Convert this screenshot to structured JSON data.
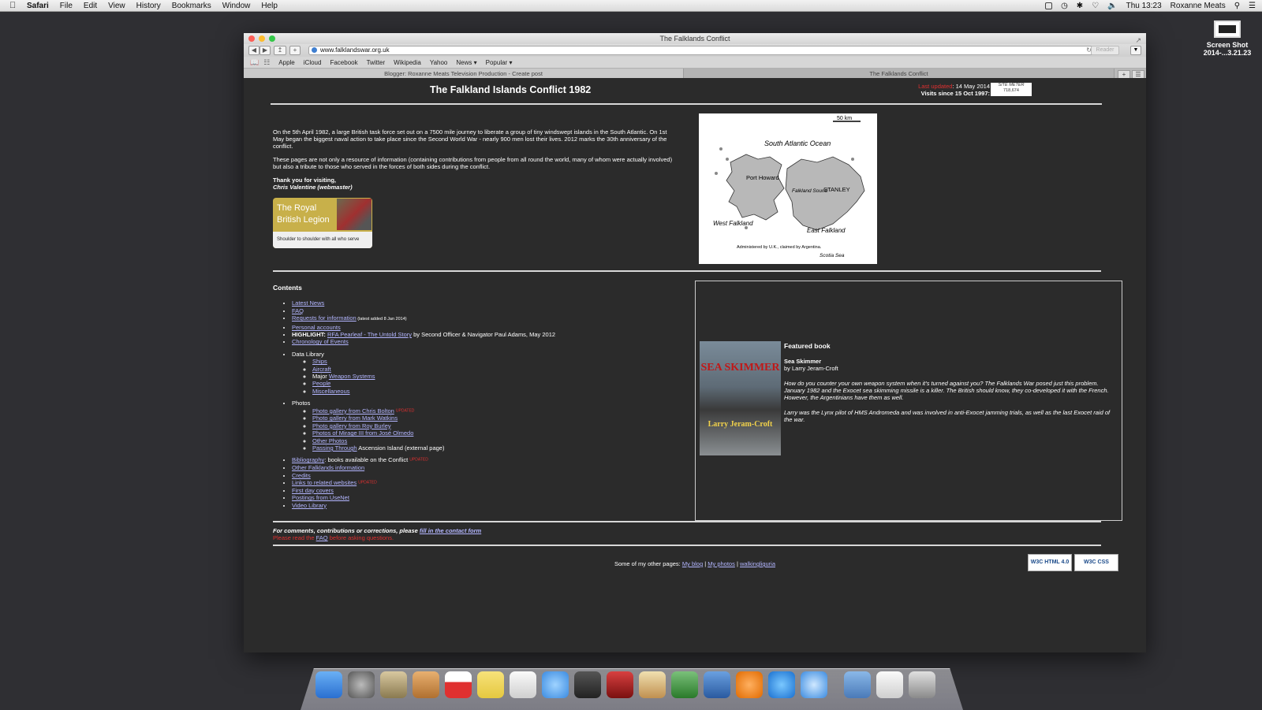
{
  "menubar": {
    "app": "Safari",
    "items": [
      "File",
      "Edit",
      "View",
      "History",
      "Bookmarks",
      "Window",
      "Help"
    ],
    "clock": "Thu 13:23",
    "user": "Roxanne Meats"
  },
  "desktop": {
    "icon_label_1": "Screen Shot",
    "icon_label_2": "2014-...3.21.23"
  },
  "window": {
    "title": "The Falklands Conflict",
    "url": "www.falklandswar.org.uk",
    "reader": "Reader",
    "bookmarks": [
      "Apple",
      "iCloud",
      "Facebook",
      "Twitter",
      "Wikipedia",
      "Yahoo",
      "News ▾",
      "Popular ▾"
    ],
    "tabs": [
      "Blogger: Roxanne Meats Television Production - Create post",
      "The Falklands Conflict"
    ]
  },
  "page": {
    "title": "The Falkland Islands Conflict 1982",
    "last_updated_label": "Last updated",
    "last_updated_value": ": 14 May 2014",
    "visits": "Visits since 15 Oct 1997:",
    "meter_label": "SITE METER",
    "meter_value": "718,674",
    "intro_p1": "On the 5th April 1982, a large British task force set out on a 7500 mile journey to liberate a group of tiny windswept islands in the South Atlantic. On 1st May began the biggest naval action to take place since the Second World War - nearly 900 men lost their lives. 2012 marks the 30th anniversary of the conflict.",
    "intro_p2": "These pages are not only a resource of information (containing contributions from people from all round the world, many of whom were actually involved) but also a tribute to those who served in the forces of both sides during the conflict.",
    "thanks": "Thank you for visiting,",
    "signature": "Chris Valentine (webmaster)",
    "legion": {
      "title": "The Royal British Legion",
      "tagline": "Shoulder to shoulder with all who serve"
    },
    "map": {
      "scale": "50 km",
      "ocean": "South Atlantic Ocean",
      "port_howard": "Port Howard",
      "falkland_sound": "Falkland Sound",
      "stanley": "STANLEY",
      "west": "West Falkland",
      "east": "East Falkland",
      "administered": "Administered by U.K., claimed by Argentina.",
      "scotia": "Scotia Sea"
    },
    "contents": {
      "heading": "Contents",
      "latest_news": "Latest News",
      "faq": "FAQ",
      "requests": "Requests for information",
      "requests_note": " (latest added 8 Jan 2014)",
      "personal": "Personal accounts",
      "highlight_label": "HIGHLIGHT: ",
      "highlight_link": "RFA Pearleaf - The Untold Story",
      "highlight_rest": " by Second Officer & Navigator Paul Adams, May 2012",
      "chronology": "Chronology of Events",
      "data_library": "Data Library",
      "ships": "Ships",
      "aircraft": "Aircraft",
      "major": "Major ",
      "weapons": "Weapon Systems",
      "people": "People",
      "misc": "Miscellaneous",
      "photos": "Photos",
      "gal1": "Photo gallery from Chris Bolton",
      "gal2": "Photo gallery from Mark Watkins",
      "gal3": "Photo gallery from Roy Burley",
      "gal4": "Photos of Mirage III from José Olmedo",
      "gal5": "Other Photos",
      "passing": "Passing Through",
      "passing_rest": " Ascension Island (external page)",
      "biblio": "Bibliography",
      "biblio_rest": ": books available on the Conflict",
      "other_info": "Other Falklands information",
      "credits": "Credits",
      "links": "Links to related websites",
      "first_day": "First day covers",
      "usenet": "Postings from UseNet",
      "video": "Video Library",
      "updated": "UPDATED"
    },
    "featured": {
      "heading": "Featured book",
      "book_title": "Sea Skimmer",
      "author": "by Larry Jeram-Croft",
      "cover_title": "SEA SKIMMER",
      "cover_author": "Larry Jeram-Croft",
      "p1": "How do you counter your own weapon system when it's turned against you? The Falklands War posed just this problem. January 1982 and the Exocet sea skimming missile is a killer. The British should know, they co-developed it with the French. However, the Argentinians have them as well.",
      "p2": "Larry was the Lynx pilot of HMS Andromeda and was involved in anti-Exocet jamming trials, as well as the last Exocet raid of the war."
    },
    "comments": "For comments, contributions or corrections, please ",
    "contact_link": "fill in the contact form",
    "read_prefix": "Please read the ",
    "read_faq": "FAQ",
    "read_suffix": " before asking questions.",
    "other_pages": "Some of my other pages: ",
    "blog": "My blog",
    "my_photos": "My photos",
    "walking": "walkingliguria",
    "sep": " | ",
    "badge_html": "W3C HTML 4.0",
    "badge_css": "W3C CSS"
  },
  "colors": {
    "accent_link": "#b3b6ff",
    "updated_red": "#e03030",
    "page_bg": "#2b2b2b"
  }
}
